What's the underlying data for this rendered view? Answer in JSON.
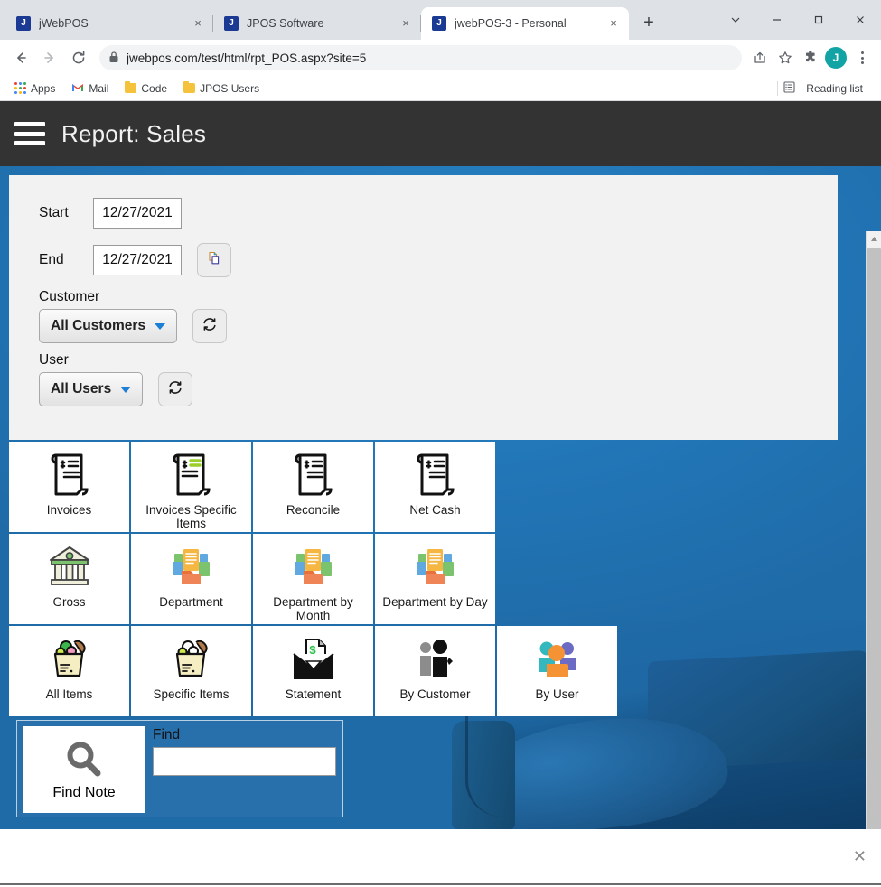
{
  "browser": {
    "tabs": [
      {
        "title": "jWebPOS",
        "favicon_letter": "J",
        "active": false,
        "close_label": "×"
      },
      {
        "title": "JPOS Software",
        "favicon_letter": "J",
        "active": false,
        "close_label": "×"
      },
      {
        "title": "jwebPOS-3 - Personal",
        "favicon_letter": "J",
        "active": true,
        "close_label": "×"
      }
    ],
    "new_tab_label": "+",
    "window_controls": {
      "tab_search": "tab-search-chevron",
      "minimize": "–",
      "maximize": "☐",
      "close": "✕"
    },
    "toolbar": {
      "back": "←",
      "forward": "→",
      "reload": "⟳",
      "lock_icon": "lock-icon",
      "url": "jwebpos.com/test/html/rpt_POS.aspx?site=5",
      "share_icon": "share-icon",
      "bookmark_icon": "star-icon",
      "extensions_icon": "puzzle-icon",
      "profile_letter": "J",
      "profile_color": "#12a4a4",
      "menu_icon": "kebab-menu-icon"
    },
    "bookmarks": [
      {
        "label": "Apps",
        "icon": "apps-grid-icon"
      },
      {
        "label": "Mail",
        "icon": "gmail-icon"
      },
      {
        "label": "Code",
        "icon": "folder-icon"
      },
      {
        "label": "JPOS Users",
        "icon": "folder-icon"
      }
    ],
    "reading_list": {
      "label": "Reading list",
      "icon": "reading-list-icon"
    }
  },
  "app": {
    "header": {
      "menu_icon": "hamburger-icon",
      "title": "Report: Sales"
    },
    "form": {
      "start": {
        "label": "Start",
        "value": "12/27/2021"
      },
      "end": {
        "label": "End",
        "value": "12/27/2021"
      },
      "copy_button": {
        "icon": "copy-icon"
      },
      "customer": {
        "label": "Customer",
        "selected": "All Customers",
        "refresh_icon": "refresh-icon"
      },
      "user": {
        "label": "User",
        "selected": "All Users",
        "refresh_icon": "refresh-icon"
      }
    },
    "tiles": [
      [
        {
          "label": "Invoices",
          "icon": "receipt-icon"
        },
        {
          "label": "Invoices Specific Items",
          "icon": "receipt-highlight-icon"
        },
        {
          "label": "Reconcile",
          "icon": "receipt-icon"
        },
        {
          "label": "Net Cash",
          "icon": "receipt-icon"
        }
      ],
      [
        {
          "label": "Gross",
          "icon": "bank-icon"
        },
        {
          "label": "Department",
          "icon": "folder-documents-icon"
        },
        {
          "label": "Department by Month",
          "icon": "folder-documents-icon"
        },
        {
          "label": "Department by Day",
          "icon": "folder-documents-icon"
        }
      ],
      [
        {
          "label": "All Items",
          "icon": "grocery-bag-icon"
        },
        {
          "label": "Specific Items",
          "icon": "grocery-bag-icon"
        },
        {
          "label": "Statement",
          "icon": "envelope-document-icon"
        },
        {
          "label": "By Customer",
          "icon": "two-people-icon"
        },
        {
          "label": "By User",
          "icon": "user-group-icon"
        }
      ]
    ],
    "find": {
      "tile_label": "Find Note",
      "tile_icon": "magnifier-icon",
      "field_label": "Find",
      "field_value": "",
      "field_placeholder": ""
    },
    "scrollbar": {
      "up": "▲",
      "down": "▼"
    },
    "close_button": "✕"
  },
  "colors": {
    "header_bg": "#333333",
    "page_bg_blue": "#2277b8",
    "panel_bg": "#f2f2f2",
    "accent_caret": "#1c7fd6",
    "profile": "#12a4a4",
    "folder_orange": "#e8703a",
    "doc_yellow": "#f6b642",
    "doc_green": "#7cc36e",
    "doc_blue": "#5fa8e0"
  }
}
